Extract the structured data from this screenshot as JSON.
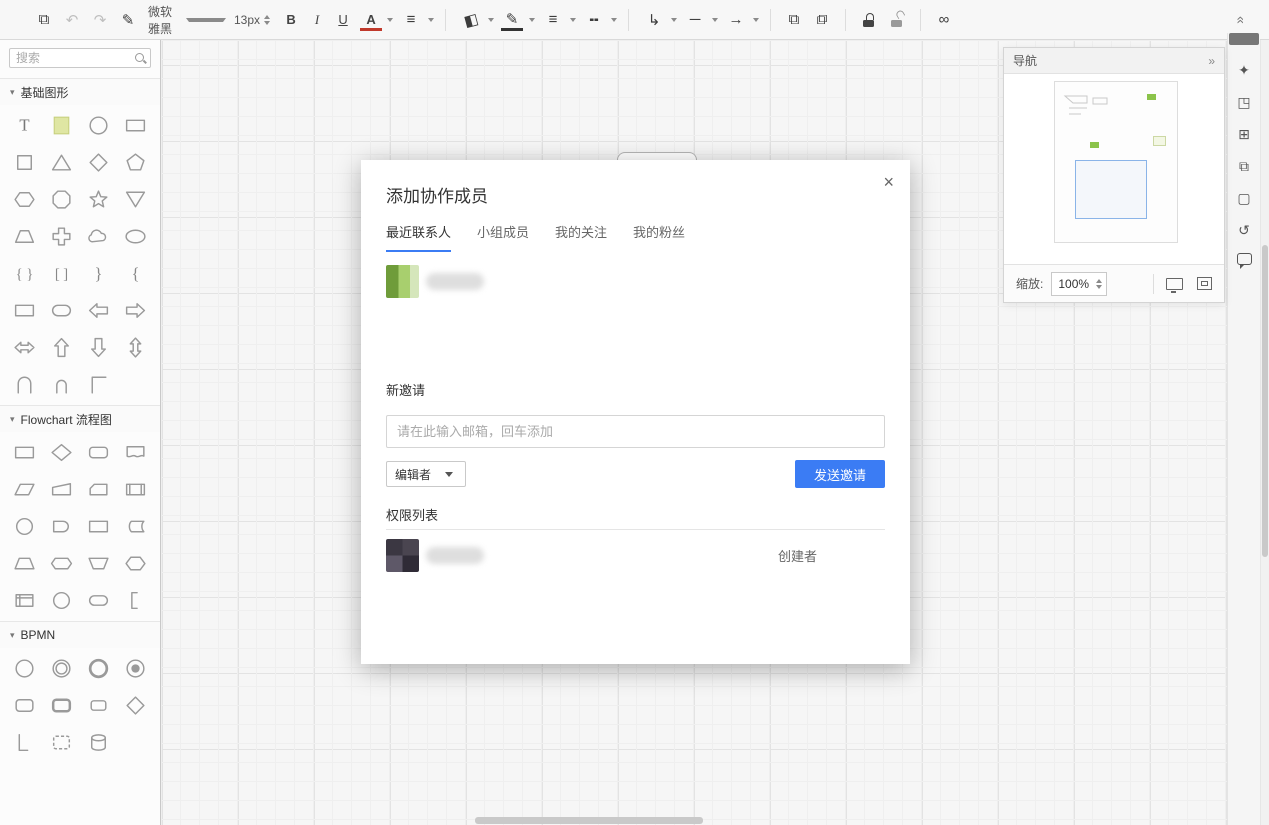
{
  "toolbar": {
    "font_name": "微软雅黑",
    "font_size": "13px",
    "bold_label": "B",
    "italic_label": "I",
    "underline_label": "U",
    "font_color_label": "A",
    "icons": {
      "pages": "⧉",
      "undo": "↶",
      "redo": "↷",
      "format_painter": "✎",
      "align": "≡",
      "fill": "◧",
      "line_color": "✎",
      "line_width": "≡",
      "line_dash": "╍",
      "connector": "↳",
      "line": "─",
      "arrow": "→",
      "bring_forward": "⧉",
      "send_backward": "⧉",
      "link": "∞",
      "collapse": "»"
    }
  },
  "left_panel": {
    "search_placeholder": "搜索",
    "sections": [
      {
        "label": "基础图形",
        "shapes": [
          "text",
          "note",
          "circle",
          "rect",
          "square",
          "triangle",
          "diamond",
          "pentagon",
          "hexagon",
          "octagon",
          "star",
          "triangle-down",
          "trapezoid",
          "cross",
          "cloud",
          "oval",
          "brace-pair",
          "bracket-pair",
          "brace-right",
          "brace-left",
          "rect",
          "rounded-rect",
          "arrow-left",
          "arrow-right",
          "arrow-double-h",
          "arrow-up",
          "arrow-down",
          "arrow-double-v",
          "arch",
          "arch-narrow",
          "corner"
        ]
      },
      {
        "label": "Flowchart 流程图",
        "shapes": [
          "fc-process",
          "fc-decision",
          "fc-rounded",
          "fc-document",
          "fc-parallelogram",
          "fc-manual-input",
          "fc-card",
          "fc-predefined",
          "fc-circle",
          "fc-delay",
          "fc-process",
          "fc-stored",
          "fc-trapezoid",
          "fc-preparation",
          "fc-inv-trapezoid",
          "fc-hexagon",
          "fc-internal",
          "fc-or",
          "fc-terminator",
          "fc-bracket"
        ]
      },
      {
        "label": "BPMN",
        "shapes": [
          "bpmn-start",
          "bpmn-intermediate",
          "bpmn-end",
          "bpmn-terminate",
          "bpmn-task",
          "bpmn-transaction",
          "bpmn-task-small",
          "bpmn-gateway",
          "bpmn-corner",
          "bpmn-group",
          "bpmn-datastore"
        ]
      }
    ]
  },
  "dialog": {
    "title": "添加协作成员",
    "close_label": "×",
    "tabs": [
      {
        "label": "最近联系人",
        "active": true
      },
      {
        "label": "小组成员",
        "active": false
      },
      {
        "label": "我的关注",
        "active": false
      },
      {
        "label": "我的粉丝",
        "active": false
      }
    ],
    "new_invite_label": "新邀请",
    "email_placeholder": "请在此输入邮箱，回车添加",
    "role_value": "编辑者",
    "send_label": "发送邀请",
    "permission_list_label": "权限列表",
    "creator_role": "创建者"
  },
  "navigator": {
    "title": "导航",
    "collapse_label": "»",
    "zoom_label": "缩放:",
    "zoom_value": "100%"
  },
  "right_toolbar": {
    "icons": [
      {
        "name": "position-icon",
        "glyph": "✦"
      },
      {
        "name": "style-icon",
        "glyph": "◳"
      },
      {
        "name": "structure-icon",
        "glyph": "⊞"
      },
      {
        "name": "multipage-icon",
        "glyph": "⧉"
      },
      {
        "name": "page-setup-icon",
        "glyph": "▢"
      },
      {
        "name": "history-icon",
        "glyph": "↺"
      },
      {
        "name": "comment-icon",
        "glyph": ""
      }
    ]
  },
  "accent_colors": {
    "primary_blue": "#3b7cf4",
    "note_green": "#8bc34a"
  }
}
